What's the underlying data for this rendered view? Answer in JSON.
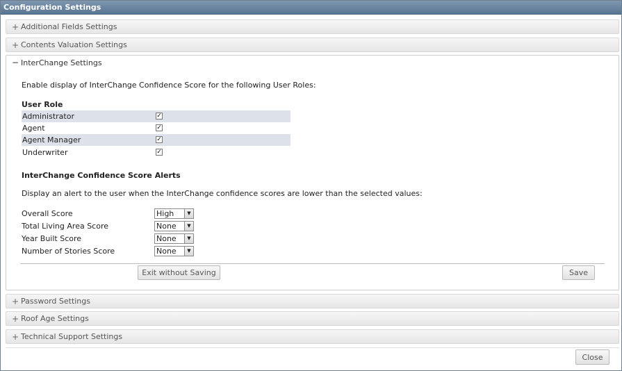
{
  "window": {
    "title": "Configuration Settings"
  },
  "sections_top": [
    {
      "sign": "+",
      "label": "Additional Fields Settings"
    },
    {
      "sign": "+",
      "label": "Contents Valuation Settings"
    }
  ],
  "interchange": {
    "sign": "−",
    "label": "InterChange Settings",
    "enable_text": "Enable display of InterChange Confidence Score for the following User Roles:",
    "role_header": "User Role",
    "roles": [
      {
        "name": "Administrator",
        "checked": "✓"
      },
      {
        "name": "Agent",
        "checked": "✓"
      },
      {
        "name": "Agent Manager",
        "checked": "✓"
      },
      {
        "name": "Underwriter",
        "checked": "✓"
      }
    ],
    "alerts_heading": "InterChange Confidence Score Alerts",
    "alerts_text": "Display an alert to the user when the InterChange confidence scores are lower than the selected values:",
    "scores": [
      {
        "label": "Overall Score",
        "value": "High"
      },
      {
        "label": "Total Living Area Score",
        "value": "None"
      },
      {
        "label": "Year Built Score",
        "value": "None"
      },
      {
        "label": "Number of Stories Score",
        "value": "None"
      }
    ],
    "exit_button": "Exit without Saving",
    "save_button": "Save"
  },
  "sections_bottom": [
    {
      "sign": "+",
      "label": "Password Settings"
    },
    {
      "sign": "+",
      "label": "Roof Age Settings"
    },
    {
      "sign": "+",
      "label": "Technical Support Settings"
    }
  ],
  "close_button": "Close",
  "colors": {
    "titlebar": "#6a84a0",
    "row_shade": "#dde2ea"
  }
}
